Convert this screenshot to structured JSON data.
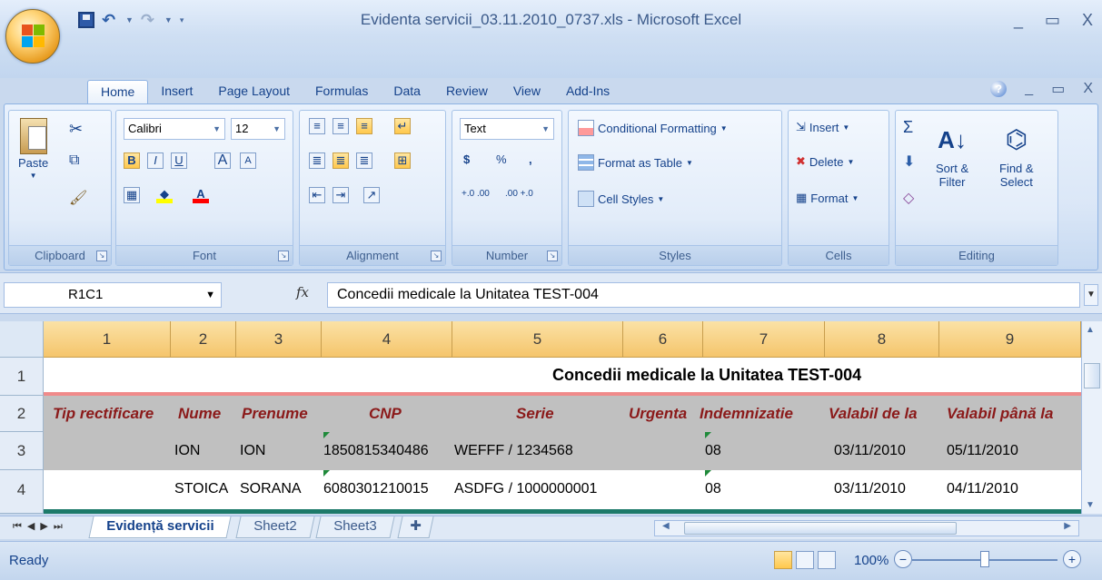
{
  "window": {
    "title": "Evidenta servicii_03.11.2010_0737.xls - Microsoft Excel",
    "minimize": "_",
    "maximize": "▭",
    "close": "X"
  },
  "ribbon_tabs": [
    "Home",
    "Insert",
    "Page Layout",
    "Formulas",
    "Data",
    "Review",
    "View",
    "Add-Ins"
  ],
  "ribbon": {
    "clipboard": {
      "paste": "Paste",
      "label": "Clipboard"
    },
    "font": {
      "name": "Calibri",
      "size": "12",
      "bold": "B",
      "italic": "I",
      "underline": "U",
      "grow": "A",
      "shrink": "A",
      "label": "Font"
    },
    "alignment": {
      "label": "Alignment"
    },
    "number": {
      "format": "Text",
      "currency": "$",
      "percent": "%",
      "comma": ",",
      "inc_dec": "+.0 .00",
      "dec_dec": ".00 +.0",
      "label": "Number"
    },
    "styles": {
      "conditional": "Conditional Formatting",
      "format_table": "Format as Table",
      "cell_styles": "Cell Styles",
      "label": "Styles"
    },
    "cells": {
      "insert": "Insert",
      "delete": "Delete",
      "format": "Format",
      "label": "Cells"
    },
    "editing": {
      "sum": "Σ",
      "sort_filter_1": "Sort &",
      "sort_filter_2": "Filter",
      "find_select_1": "Find &",
      "find_select_2": "Select",
      "label": "Editing"
    }
  },
  "formula_bar": {
    "name_box": "R1C1",
    "fx": "fx",
    "formula": "Concedii medicale la Unitatea TEST-004"
  },
  "columns": [
    "1",
    "2",
    "3",
    "4",
    "5",
    "6",
    "7",
    "8",
    "9"
  ],
  "rows": [
    {
      "num": "1",
      "title": "Concedii medicale la Unitatea TEST-004"
    },
    {
      "num": "2",
      "cells": [
        "Tip rectificare",
        "Nume",
        "Prenume",
        "CNP",
        "Serie",
        "Urgenta",
        "Indemnizatie",
        "Valabil de la",
        "Valabil până la"
      ]
    },
    {
      "num": "3",
      "cells": [
        "",
        "ION",
        "ION",
        "1850815340486",
        "WEFFF / 1234568",
        "",
        "08",
        "03/11/2010",
        "05/11/2010"
      ]
    },
    {
      "num": "4",
      "cells": [
        "",
        "STOICA",
        "SORANA",
        "6080301210015",
        "ASDFG / 1000000001",
        "",
        "08",
        "03/11/2010",
        "04/11/2010"
      ]
    }
  ],
  "sheets": [
    "Evidență servicii",
    "Sheet2",
    "Sheet3"
  ],
  "status": {
    "ready": "Ready",
    "zoom": "100%",
    "zoom_level": 1.0
  },
  "colors": {
    "header_text": "#8b1a1a",
    "row_shade": "#c0c0c0",
    "accent_line": "#f08a8a",
    "bottom_line": "#1d7a6a"
  }
}
